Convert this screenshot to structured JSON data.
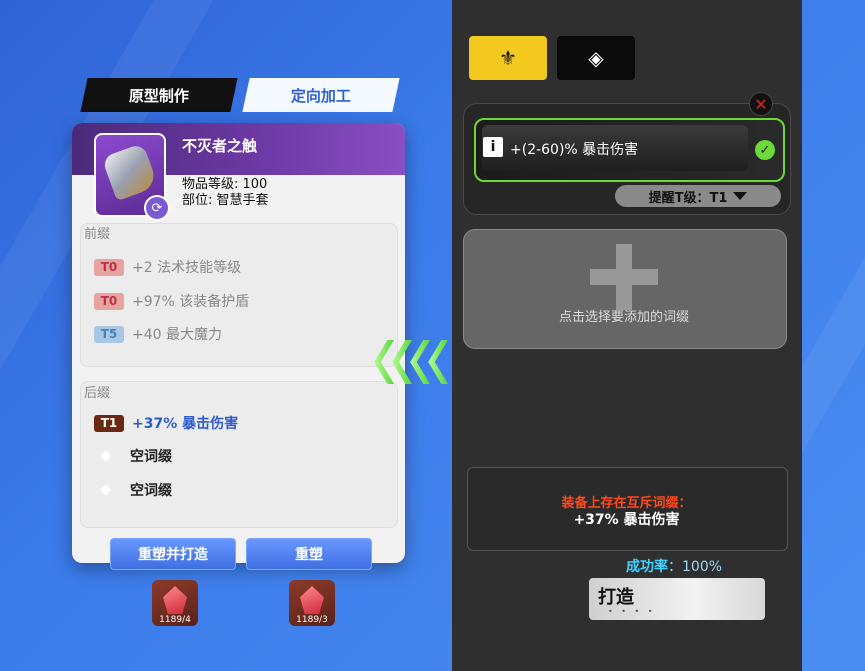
{
  "tabs": [
    {
      "label": "原型制作",
      "active": true
    },
    {
      "label": "定向加工",
      "active": false
    }
  ],
  "item": {
    "name": "不灭者之触",
    "level_line": "物品等级: 100",
    "slot_line": "部位: 智慧手套",
    "icon": "gauntlet-icon",
    "refresh_icon": "refresh-icon"
  },
  "prefix": {
    "title": "前缀",
    "affixes": [
      {
        "tier": "T0",
        "text": "+2 法术技能等级"
      },
      {
        "tier": "T0",
        "text": "+97% 该装备护盾"
      },
      {
        "tier": "T5",
        "text": "+40 最大魔力"
      }
    ]
  },
  "suffix": {
    "title": "后缀",
    "affixes": [
      {
        "tier": "T1",
        "text": "+37% 暴击伤害"
      },
      {
        "tier": "",
        "text": "空词缀"
      },
      {
        "tier": "",
        "text": "空词缀"
      }
    ]
  },
  "buttons": {
    "reforge_and_craft": "重塑并打造",
    "reforge": "重塑"
  },
  "materials": [
    {
      "icon": "crystal-icon",
      "count": "1189/4"
    },
    {
      "icon": "crystal-icon",
      "count": "1189/3"
    }
  ],
  "right": {
    "top_buttons": [
      {
        "icon": "trident-emblem-icon",
        "color": "#f3c91f"
      },
      {
        "icon": "diamond-arrow-icon",
        "color": "#0b0b0b"
      }
    ],
    "selected_affix": "+(2-60)% 暴击伤害",
    "remind_label": "提醒T级：T1",
    "add_affix_hint": "点击选择要添加的词缀",
    "conflict_title": "装备上存在互斥词缀：",
    "conflict_affix": "+37% 暴击伤害",
    "success_label": "成功率",
    "success_value": "：100%",
    "forge_label": "打造",
    "forge_dots": "• • • •"
  },
  "colors": {
    "accent_green": "#6bd93a",
    "accent_blue": "#3f6fe2",
    "warning_red": "#ff4a1c",
    "rate_cyan": "#47d2ff"
  }
}
